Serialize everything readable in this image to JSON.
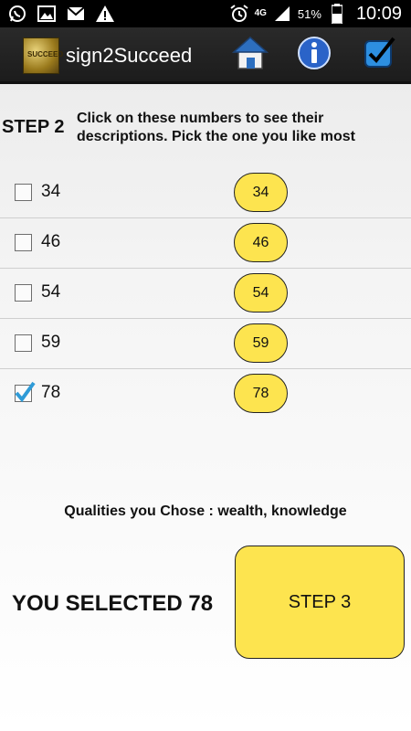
{
  "status_bar": {
    "icons_left": [
      "whatsapp-icon",
      "image-icon",
      "gmail-icon",
      "warning-icon"
    ],
    "network": "4G",
    "battery": "51%",
    "time": "10:09"
  },
  "action_bar": {
    "title": "sign2Succeed",
    "logo_text": "SUCCEED",
    "buttons": [
      "home-icon",
      "info-icon",
      "checkbox-icon"
    ]
  },
  "step": {
    "label": "STEP 2",
    "description": "Click on these numbers to see their descriptions. Pick the one you like most"
  },
  "numbers": [
    {
      "label": "34",
      "button": "34",
      "checked": false
    },
    {
      "label": "46",
      "button": "46",
      "checked": false
    },
    {
      "label": "54",
      "button": "54",
      "checked": false
    },
    {
      "label": "59",
      "button": "59",
      "checked": false
    },
    {
      "label": "78",
      "button": "78",
      "checked": true
    }
  ],
  "qualities_text": "Qualities you Chose : wealth, knowledge",
  "selected_text": "YOU SELECTED 78",
  "next_button": "STEP 3",
  "colors": {
    "accent_yellow": "#fde44f",
    "check_blue": "#2f9bd7",
    "actionbar": "#222222"
  }
}
